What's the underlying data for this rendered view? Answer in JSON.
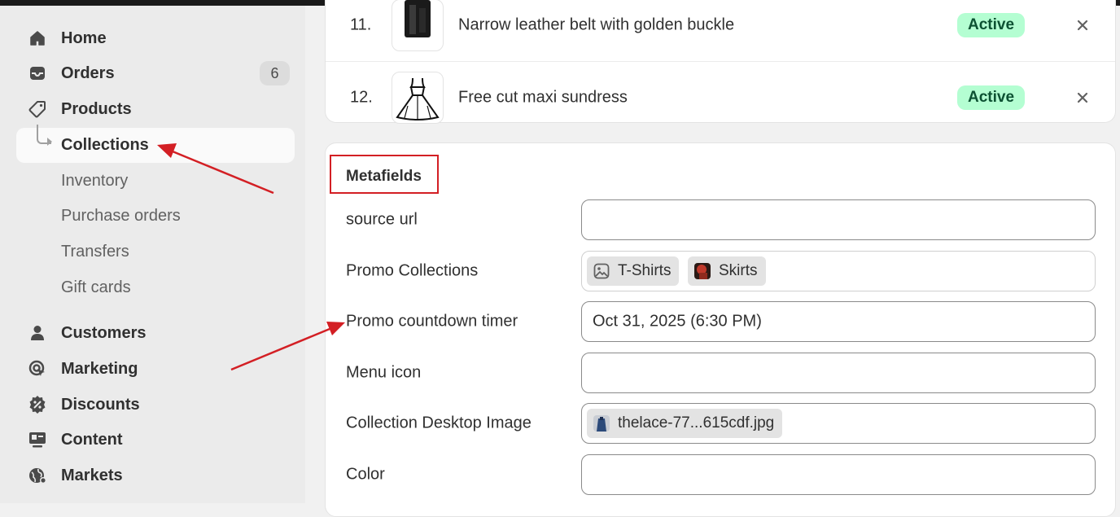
{
  "sidebar": {
    "items": [
      {
        "label": "Home",
        "icon": "home-icon"
      },
      {
        "label": "Orders",
        "icon": "inbox-icon",
        "badge": "6"
      },
      {
        "label": "Products",
        "icon": "tag-icon"
      },
      {
        "label": "Collections",
        "active": true
      },
      {
        "label": "Inventory"
      },
      {
        "label": "Purchase orders"
      },
      {
        "label": "Transfers"
      },
      {
        "label": "Gift cards"
      },
      {
        "label": "Customers",
        "icon": "person-icon"
      },
      {
        "label": "Marketing",
        "icon": "target-icon"
      },
      {
        "label": "Discounts",
        "icon": "discount-icon"
      },
      {
        "label": "Content",
        "icon": "content-icon"
      },
      {
        "label": "Markets",
        "icon": "globe-icon"
      }
    ]
  },
  "products": {
    "rows": [
      {
        "number": "11.",
        "title": "Narrow leather belt with golden buckle",
        "status": "Active",
        "thumb": "belt-thumbnail"
      },
      {
        "number": "12.",
        "title": "Free cut maxi sundress",
        "status": "Active",
        "thumb": "dress-thumbnail"
      }
    ]
  },
  "metafields": {
    "title": "Metafields",
    "rows": [
      {
        "label": "source url",
        "value": ""
      },
      {
        "label": "Promo Collections",
        "tags": [
          "T-Shirts",
          "Skirts"
        ]
      },
      {
        "label": "Promo countdown timer",
        "value": "Oct 31, 2025 (6:30 PM)"
      },
      {
        "label": "Menu icon",
        "value": ""
      },
      {
        "label": "Collection Desktop Image",
        "tags": [
          "thelace-77...615cdf.jpg"
        ]
      },
      {
        "label": "Color",
        "value": ""
      }
    ]
  },
  "colors": {
    "status_bg": "#b4fed2",
    "status_text": "#0c5132",
    "annotation_red": "#d31f24"
  }
}
